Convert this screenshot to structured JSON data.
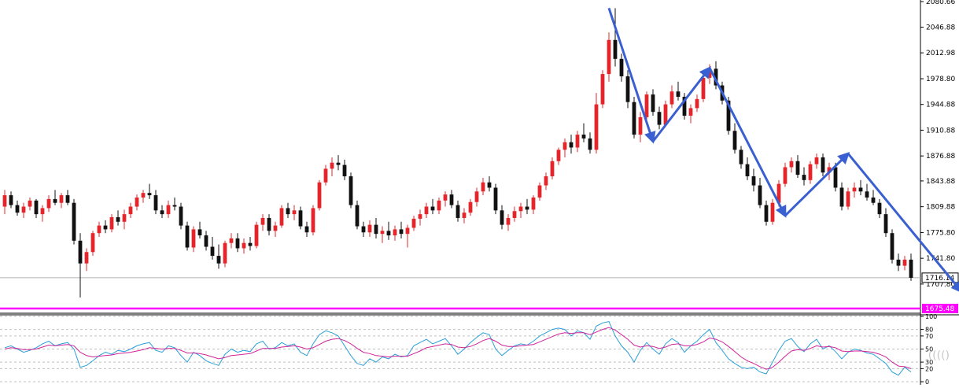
{
  "chart_data": {
    "type": "candlestick",
    "colors": {
      "up": "#e3262b",
      "down": "#111111",
      "arrow": "#3a5fd0",
      "support_line": "#ff00ff",
      "current_price_line": "#b4b4b4",
      "rsi_fast": "#2a9fd8",
      "rsi_slow": "#d0239a",
      "grid": "#c0c0c0"
    },
    "price_axis": {
      "ylim": [
        1675.48,
        2080.66
      ],
      "ticks": [
        "2080.66",
        "2046.88",
        "2012.98",
        "1978.80",
        "1944.88",
        "1910.88",
        "1876.88",
        "1843.88",
        "1809.88",
        "1775.80",
        "1741.80",
        "1707.80"
      ]
    },
    "current_price_label": "1716.14",
    "current_price": 1716.14,
    "support_label": "1675.48",
    "support_price": 1675.48,
    "candles_ohlc": [
      [
        1810,
        1832,
        1800,
        1825
      ],
      [
        1825,
        1830,
        1808,
        1812
      ],
      [
        1812,
        1818,
        1798,
        1802
      ],
      [
        1802,
        1815,
        1795,
        1810
      ],
      [
        1810,
        1822,
        1805,
        1818
      ],
      [
        1818,
        1820,
        1795,
        1800
      ],
      [
        1800,
        1812,
        1790,
        1808
      ],
      [
        1808,
        1825,
        1803,
        1820
      ],
      [
        1820,
        1832,
        1812,
        1815
      ],
      [
        1815,
        1828,
        1808,
        1825
      ],
      [
        1825,
        1832,
        1812,
        1815
      ],
      [
        1815,
        1820,
        1760,
        1765
      ],
      [
        1765,
        1775,
        1690,
        1735
      ],
      [
        1735,
        1755,
        1725,
        1750
      ],
      [
        1750,
        1778,
        1745,
        1775
      ],
      [
        1775,
        1790,
        1770,
        1785
      ],
      [
        1785,
        1792,
        1775,
        1780
      ],
      [
        1780,
        1800,
        1776,
        1796
      ],
      [
        1796,
        1805,
        1785,
        1790
      ],
      [
        1790,
        1806,
        1780,
        1800
      ],
      [
        1800,
        1815,
        1795,
        1810
      ],
      [
        1810,
        1826,
        1805,
        1822
      ],
      [
        1822,
        1832,
        1815,
        1828
      ],
      [
        1828,
        1840,
        1820,
        1825
      ],
      [
        1825,
        1832,
        1800,
        1805
      ],
      [
        1805,
        1812,
        1795,
        1800
      ],
      [
        1800,
        1818,
        1795,
        1812
      ],
      [
        1812,
        1822,
        1805,
        1810
      ],
      [
        1810,
        1815,
        1780,
        1785
      ],
      [
        1785,
        1790,
        1752,
        1756
      ],
      [
        1756,
        1784,
        1750,
        1780
      ],
      [
        1780,
        1790,
        1768,
        1772
      ],
      [
        1772,
        1778,
        1752,
        1757
      ],
      [
        1757,
        1770,
        1740,
        1745
      ],
      [
        1745,
        1760,
        1728,
        1735
      ],
      [
        1735,
        1765,
        1730,
        1762
      ],
      [
        1762,
        1775,
        1755,
        1768
      ],
      [
        1768,
        1775,
        1750,
        1755
      ],
      [
        1755,
        1768,
        1748,
        1762
      ],
      [
        1762,
        1770,
        1752,
        1758
      ],
      [
        1758,
        1790,
        1755,
        1786
      ],
      [
        1786,
        1800,
        1778,
        1795
      ],
      [
        1795,
        1800,
        1772,
        1778
      ],
      [
        1778,
        1790,
        1770,
        1785
      ],
      [
        1785,
        1812,
        1782,
        1808
      ],
      [
        1808,
        1815,
        1795,
        1800
      ],
      [
        1800,
        1812,
        1792,
        1805
      ],
      [
        1805,
        1810,
        1780,
        1784
      ],
      [
        1784,
        1790,
        1770,
        1776
      ],
      [
        1776,
        1812,
        1772,
        1808
      ],
      [
        1808,
        1845,
        1805,
        1842
      ],
      [
        1842,
        1865,
        1838,
        1860
      ],
      [
        1860,
        1875,
        1850,
        1868
      ],
      [
        1868,
        1878,
        1858,
        1865
      ],
      [
        1865,
        1872,
        1845,
        1850
      ],
      [
        1850,
        1855,
        1808,
        1812
      ],
      [
        1812,
        1818,
        1780,
        1784
      ],
      [
        1784,
        1790,
        1770,
        1776
      ],
      [
        1776,
        1792,
        1770,
        1786
      ],
      [
        1786,
        1795,
        1768,
        1774
      ],
      [
        1774,
        1784,
        1762,
        1778
      ],
      [
        1778,
        1790,
        1766,
        1772
      ],
      [
        1772,
        1785,
        1765,
        1780
      ],
      [
        1780,
        1790,
        1768,
        1774
      ],
      [
        1774,
        1786,
        1756,
        1782
      ],
      [
        1782,
        1798,
        1778,
        1794
      ],
      [
        1794,
        1806,
        1785,
        1800
      ],
      [
        1800,
        1815,
        1795,
        1810
      ],
      [
        1810,
        1820,
        1800,
        1805
      ],
      [
        1805,
        1822,
        1800,
        1818
      ],
      [
        1818,
        1830,
        1810,
        1826
      ],
      [
        1826,
        1832,
        1808,
        1812
      ],
      [
        1812,
        1818,
        1790,
        1795
      ],
      [
        1795,
        1808,
        1788,
        1802
      ],
      [
        1802,
        1820,
        1798,
        1816
      ],
      [
        1816,
        1835,
        1810,
        1830
      ],
      [
        1830,
        1848,
        1825,
        1842
      ],
      [
        1842,
        1850,
        1830,
        1835
      ],
      [
        1835,
        1840,
        1800,
        1805
      ],
      [
        1805,
        1812,
        1780,
        1786
      ],
      [
        1786,
        1800,
        1778,
        1795
      ],
      [
        1795,
        1810,
        1790,
        1804
      ],
      [
        1804,
        1815,
        1795,
        1810
      ],
      [
        1810,
        1820,
        1800,
        1806
      ],
      [
        1806,
        1825,
        1800,
        1822
      ],
      [
        1822,
        1842,
        1818,
        1838
      ],
      [
        1838,
        1855,
        1832,
        1850
      ],
      [
        1850,
        1875,
        1846,
        1870
      ],
      [
        1870,
        1888,
        1865,
        1885
      ],
      [
        1885,
        1900,
        1875,
        1895
      ],
      [
        1895,
        1905,
        1880,
        1888
      ],
      [
        1888,
        1910,
        1882,
        1905
      ],
      [
        1905,
        1920,
        1895,
        1900
      ],
      [
        1900,
        1908,
        1880,
        1885
      ],
      [
        1885,
        1960,
        1880,
        1945
      ],
      [
        1945,
        1990,
        1940,
        1985
      ],
      [
        1985,
        2040,
        1975,
        2030
      ],
      [
        2030,
        2072,
        1995,
        2005
      ],
      [
        2005,
        2012,
        1975,
        1982
      ],
      [
        1982,
        1990,
        1940,
        1948
      ],
      [
        1948,
        1955,
        1900,
        1905
      ],
      [
        1905,
        1935,
        1895,
        1928
      ],
      [
        1928,
        1962,
        1925,
        1958
      ],
      [
        1958,
        1965,
        1930,
        1935
      ],
      [
        1935,
        1942,
        1912,
        1918
      ],
      [
        1918,
        1950,
        1915,
        1945
      ],
      [
        1945,
        1970,
        1940,
        1962
      ],
      [
        1962,
        1975,
        1950,
        1955
      ],
      [
        1955,
        1960,
        1925,
        1930
      ],
      [
        1930,
        1945,
        1920,
        1940
      ],
      [
        1940,
        1958,
        1935,
        1952
      ],
      [
        1952,
        1985,
        1948,
        1980
      ],
      [
        1980,
        1998,
        1972,
        1992
      ],
      [
        1992,
        2002,
        1965,
        1970
      ],
      [
        1970,
        1975,
        1945,
        1950
      ],
      [
        1950,
        1955,
        1905,
        1910
      ],
      [
        1910,
        1920,
        1880,
        1885
      ],
      [
        1885,
        1890,
        1860,
        1866
      ],
      [
        1866,
        1875,
        1845,
        1850
      ],
      [
        1850,
        1860,
        1830,
        1838
      ],
      [
        1838,
        1848,
        1808,
        1812
      ],
      [
        1812,
        1818,
        1785,
        1790
      ],
      [
        1790,
        1820,
        1786,
        1815
      ],
      [
        1815,
        1845,
        1810,
        1840
      ],
      [
        1840,
        1868,
        1836,
        1862
      ],
      [
        1862,
        1875,
        1855,
        1870
      ],
      [
        1870,
        1878,
        1848,
        1852
      ],
      [
        1852,
        1862,
        1838,
        1845
      ],
      [
        1845,
        1870,
        1840,
        1866
      ],
      [
        1866,
        1880,
        1860,
        1875
      ],
      [
        1875,
        1880,
        1850,
        1855
      ],
      [
        1855,
        1868,
        1845,
        1862
      ],
      [
        1862,
        1868,
        1830,
        1835
      ],
      [
        1835,
        1842,
        1805,
        1810
      ],
      [
        1810,
        1835,
        1806,
        1830
      ],
      [
        1830,
        1842,
        1822,
        1835
      ],
      [
        1835,
        1845,
        1825,
        1830
      ],
      [
        1830,
        1840,
        1818,
        1822
      ],
      [
        1822,
        1832,
        1812,
        1815
      ],
      [
        1815,
        1820,
        1795,
        1800
      ],
      [
        1800,
        1808,
        1770,
        1775
      ],
      [
        1775,
        1780,
        1735,
        1740
      ],
      [
        1740,
        1748,
        1725,
        1732
      ],
      [
        1732,
        1745,
        1726,
        1740
      ],
      [
        1740,
        1748,
        1712,
        1716
      ]
    ],
    "pattern_arrows": [
      {
        "from": [
          96,
          2072
        ],
        "to": [
          103,
          1896
        ]
      },
      {
        "from": [
          103,
          1896
        ],
        "to": [
          112,
          1993
        ]
      },
      {
        "from": [
          112,
          1993
        ],
        "to": [
          124,
          1798
        ]
      },
      {
        "from": [
          124,
          1798
        ],
        "to": [
          134,
          1880
        ]
      },
      {
        "from": [
          134,
          1880
        ],
        "to": [
          152,
          1698
        ]
      },
      {
        "from": [
          152,
          1698
        ],
        "to": [
          158,
          1781
        ]
      }
    ],
    "rsi": {
      "ylim": [
        0,
        100
      ],
      "ticks": [
        "100",
        "80",
        "70",
        "50",
        "30",
        "20",
        "0"
      ],
      "levels": [
        100,
        80,
        70,
        50,
        30,
        20,
        0
      ],
      "fast": [
        52,
        55,
        50,
        45,
        48,
        52,
        58,
        62,
        55,
        58,
        60,
        50,
        22,
        25,
        32,
        40,
        45,
        42,
        48,
        46,
        50,
        55,
        58,
        60,
        48,
        45,
        55,
        52,
        40,
        30,
        45,
        40,
        32,
        28,
        25,
        42,
        50,
        45,
        48,
        46,
        58,
        62,
        50,
        52,
        60,
        55,
        58,
        45,
        40,
        58,
        72,
        78,
        75,
        70,
        55,
        40,
        28,
        25,
        35,
        30,
        38,
        35,
        42,
        38,
        40,
        55,
        60,
        65,
        58,
        62,
        66,
        55,
        42,
        50,
        60,
        68,
        75,
        72,
        50,
        40,
        48,
        55,
        58,
        56,
        62,
        70,
        75,
        80,
        82,
        80,
        70,
        78,
        75,
        65,
        85,
        90,
        92,
        70,
        55,
        45,
        30,
        48,
        60,
        50,
        42,
        58,
        66,
        60,
        45,
        55,
        62,
        72,
        80,
        60,
        48,
        35,
        28,
        22,
        20,
        22,
        15,
        12,
        30,
        48,
        62,
        66,
        54,
        46,
        58,
        65,
        50,
        55,
        46,
        35,
        45,
        50,
        48,
        44,
        42,
        35,
        28,
        15,
        10,
        22,
        15
      ],
      "slow": [
        50,
        52,
        51,
        49,
        49,
        50,
        53,
        56,
        55,
        56,
        57,
        55,
        45,
        40,
        38,
        39,
        40,
        41,
        43,
        44,
        45,
        47,
        49,
        52,
        51,
        50,
        51,
        51,
        48,
        44,
        44,
        43,
        41,
        38,
        35,
        37,
        40,
        41,
        42,
        43,
        47,
        51,
        51,
        51,
        53,
        54,
        55,
        53,
        50,
        52,
        57,
        62,
        65,
        66,
        63,
        58,
        51,
        45,
        43,
        40,
        39,
        38,
        39,
        39,
        39,
        43,
        47,
        52,
        54,
        56,
        58,
        57,
        53,
        52,
        54,
        58,
        63,
        66,
        62,
        56,
        54,
        54,
        55,
        56,
        57,
        61,
        65,
        69,
        73,
        75,
        74,
        75,
        75,
        72,
        76,
        80,
        83,
        79,
        72,
        65,
        56,
        53,
        55,
        54,
        51,
        53,
        57,
        58,
        55,
        55,
        57,
        61,
        67,
        65,
        61,
        54,
        46,
        38,
        32,
        28,
        23,
        19,
        22,
        30,
        39,
        47,
        49,
        48,
        51,
        55,
        53,
        54,
        52,
        47,
        46,
        47,
        47,
        46,
        45,
        42,
        38,
        30,
        24,
        23,
        20
      ]
    }
  }
}
